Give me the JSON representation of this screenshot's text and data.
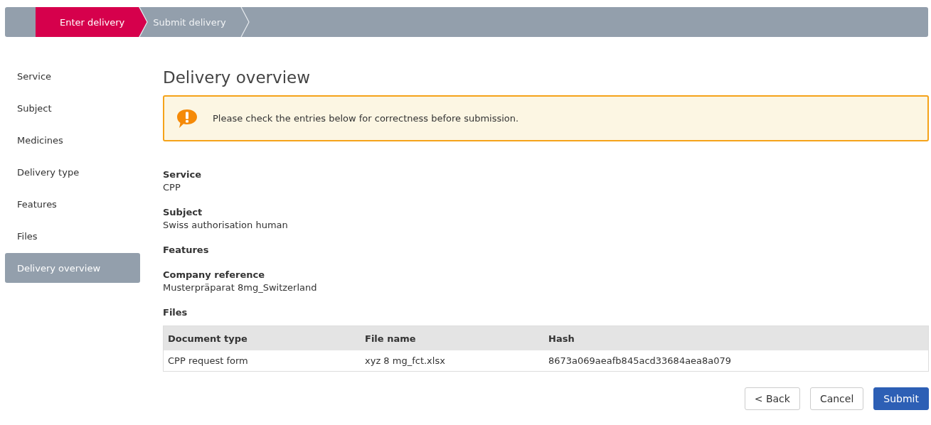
{
  "steps": [
    {
      "label": "Enter delivery",
      "selected": true
    },
    {
      "label": "Submit delivery",
      "selected": false
    }
  ],
  "sidebar": {
    "items": [
      {
        "label": "Service",
        "selected": false
      },
      {
        "label": "Subject",
        "selected": false
      },
      {
        "label": "Medicines",
        "selected": false
      },
      {
        "label": "Delivery type",
        "selected": false
      },
      {
        "label": "Features",
        "selected": false
      },
      {
        "label": "Files",
        "selected": false
      },
      {
        "label": "Delivery overview",
        "selected": true
      }
    ]
  },
  "heading": "Delivery overview",
  "alert": {
    "message": "Please check the entries below for correctness before submission."
  },
  "fields": [
    {
      "label": "Service",
      "value": "CPP"
    },
    {
      "label": "Subject",
      "value": "Swiss authorisation human"
    },
    {
      "label": "Features"
    },
    {
      "label": "Company reference",
      "value": "Musterpräparat 8mg_Switzerland"
    },
    {
      "label": "Files"
    }
  ],
  "table": {
    "columns": [
      "Document type",
      "File name",
      "Hash"
    ],
    "rows": [
      [
        "CPP request form",
        "xyz 8 mg_fct.xlsx",
        "8673a069aeafb845acd33684aea8a079"
      ]
    ]
  },
  "buttons": [
    {
      "label": "< Back",
      "kind": "default"
    },
    {
      "label": "Cancel",
      "kind": "default"
    },
    {
      "label": "Submit",
      "kind": "primary"
    }
  ]
}
